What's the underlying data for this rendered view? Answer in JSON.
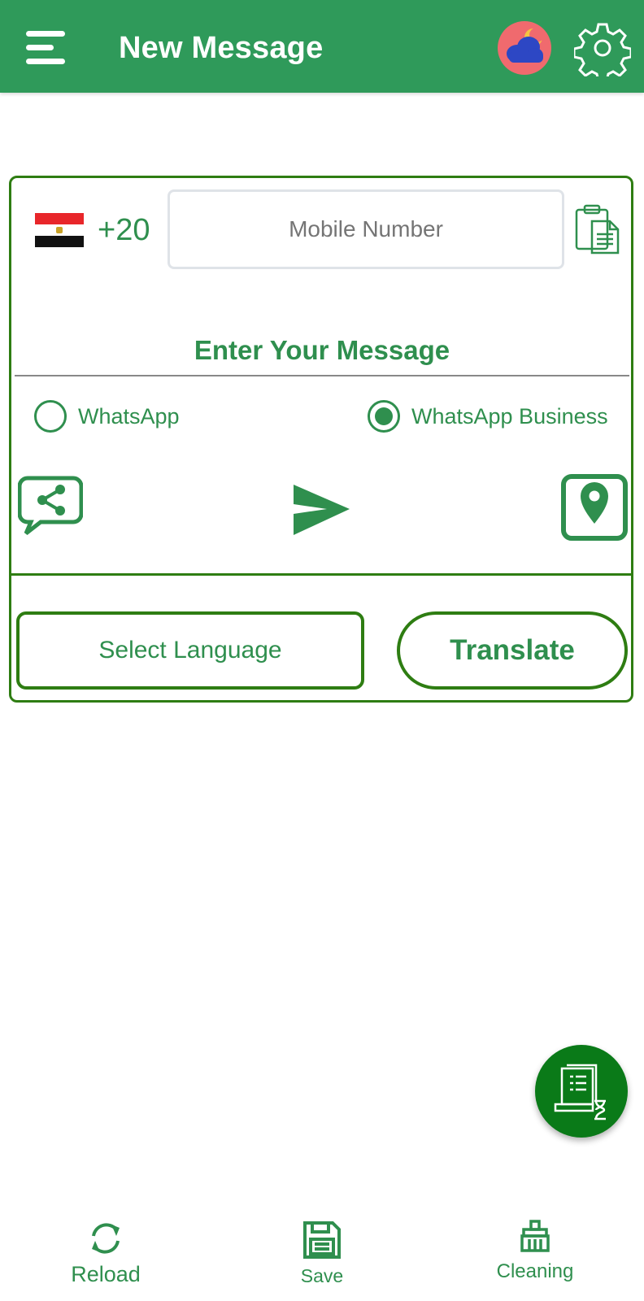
{
  "header": {
    "title": "New Message",
    "menu_icon": "menu-icon",
    "weather_icon": "weather-night-cloud-icon",
    "settings_icon": "gear-icon"
  },
  "phone": {
    "country_flag": "egypt-flag",
    "country_code": "+20",
    "mobile_placeholder": "Mobile Number",
    "paste_icon": "clipboard-paste-icon"
  },
  "message": {
    "label": "Enter Your Message"
  },
  "app_choice": {
    "options": [
      {
        "label": "WhatsApp",
        "selected": false
      },
      {
        "label": "WhatsApp Business",
        "selected": true
      }
    ]
  },
  "actions": {
    "share_icon": "share-chat-icon",
    "send_icon": "send-icon",
    "location_icon": "location-pin-icon"
  },
  "translation": {
    "select_language_label": "Select Language",
    "translate_label": "Translate"
  },
  "fab": {
    "icon": "scheduled-messages-icon"
  },
  "bottom_nav": {
    "items": [
      {
        "label": "Reload",
        "icon": "reload-icon"
      },
      {
        "label": "Save",
        "icon": "save-icon"
      },
      {
        "label": "Cleaning",
        "icon": "broom-cleaning-icon"
      }
    ]
  },
  "colors": {
    "appbar": "#2f9a5a",
    "accent_text": "#2f8f4e",
    "border": "#2e7d12",
    "fab": "#0a7a18"
  }
}
